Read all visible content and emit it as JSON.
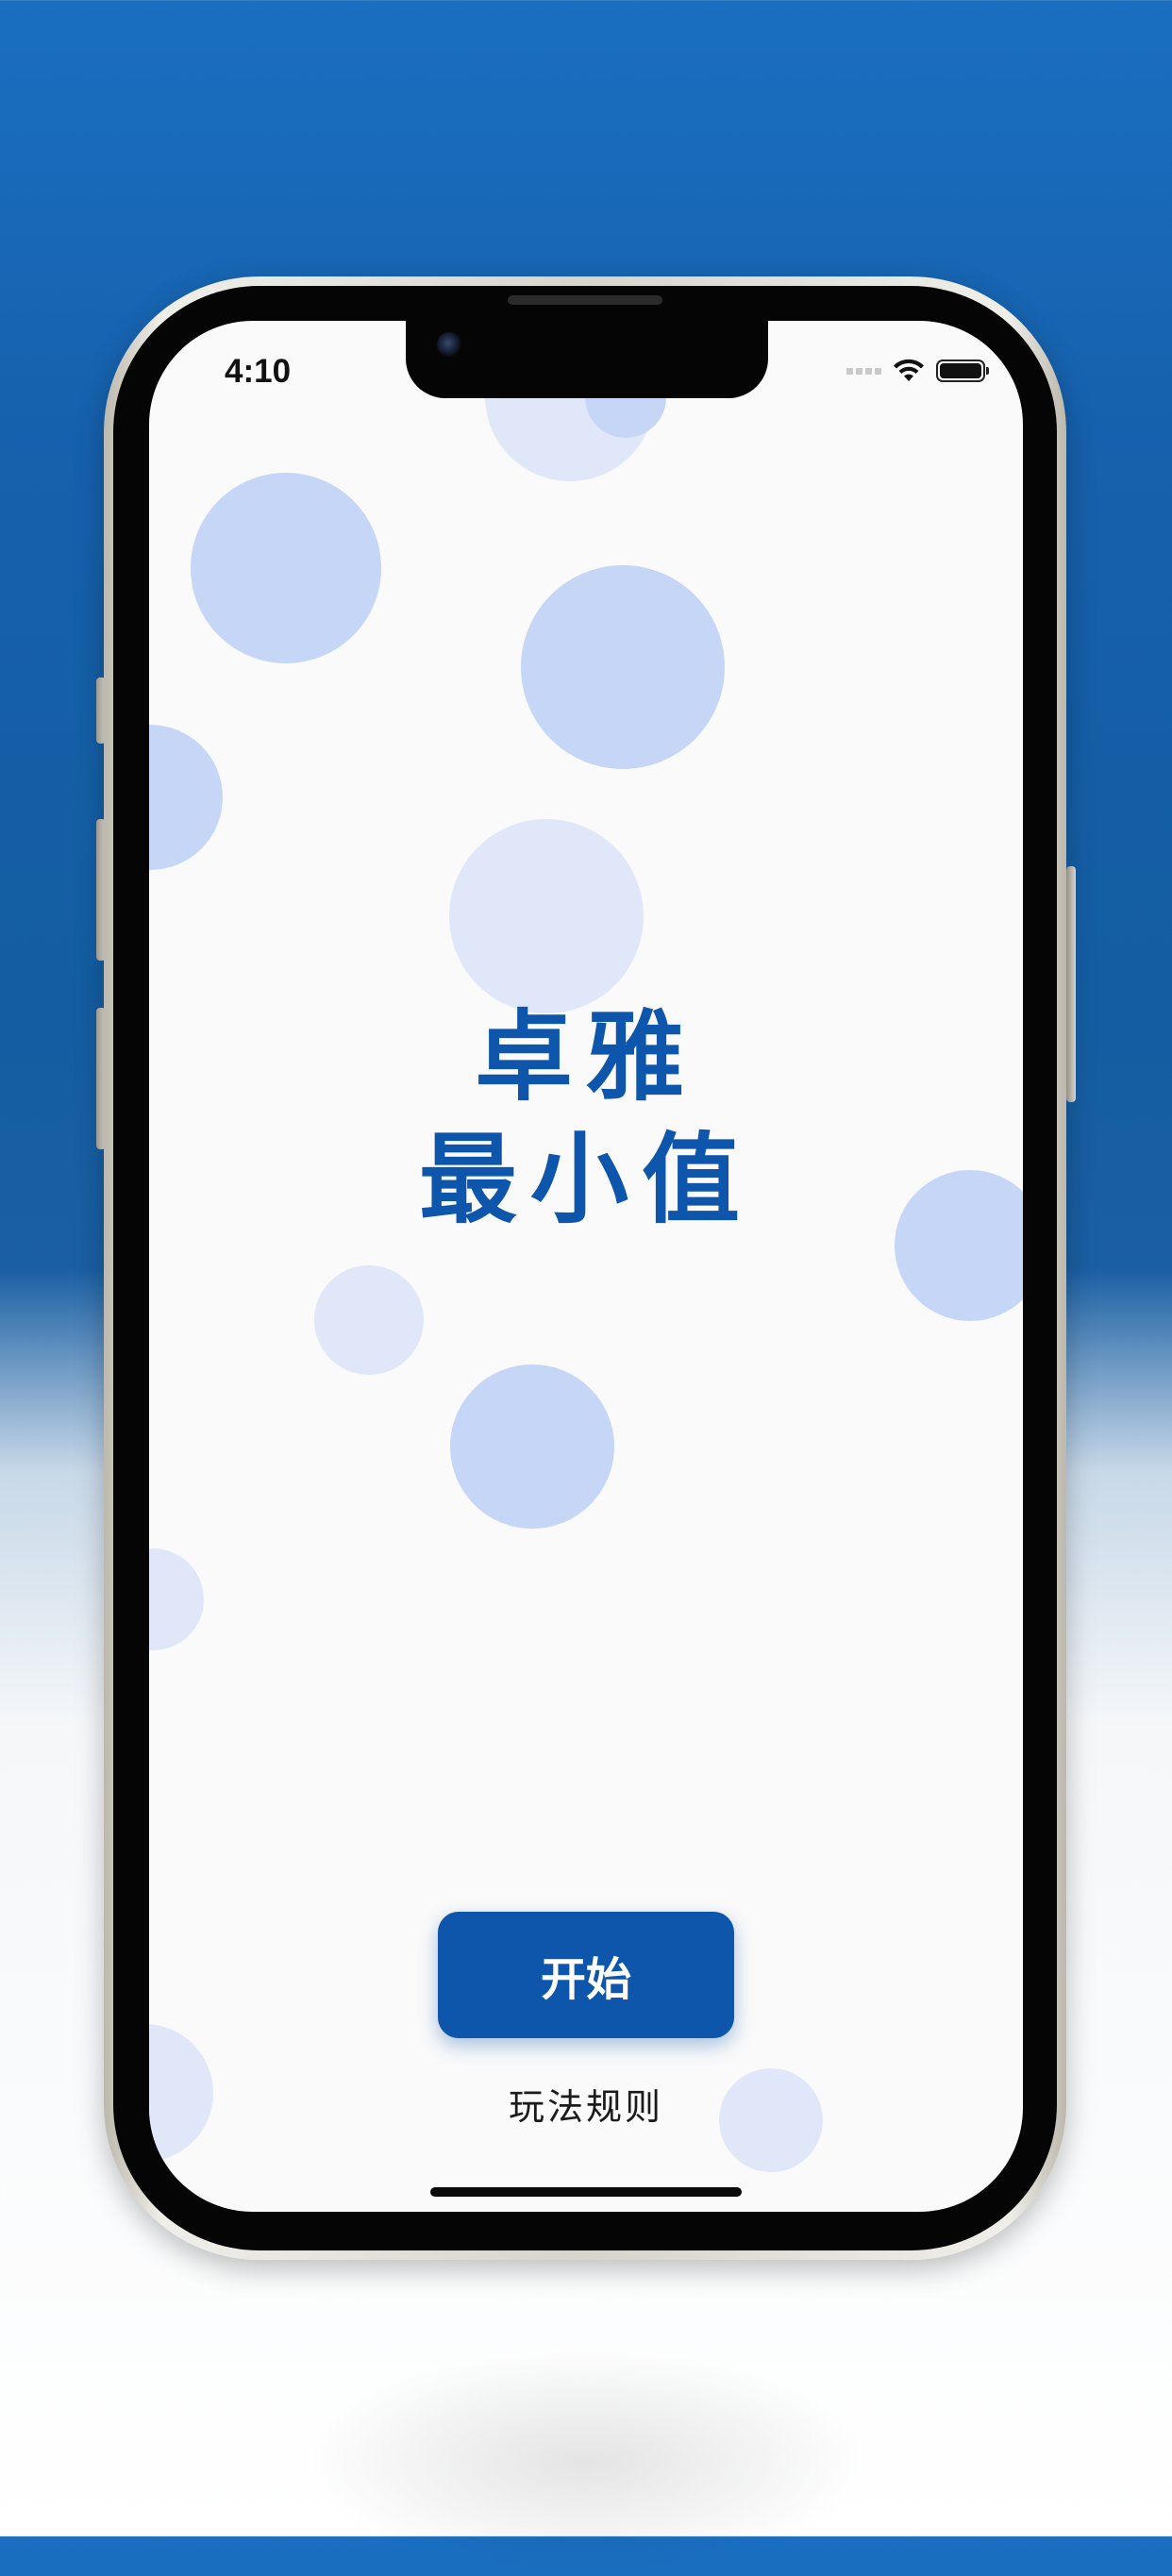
{
  "status_bar": {
    "time": "4:10",
    "icons": [
      "signal-icon",
      "wifi-icon",
      "battery-icon"
    ]
  },
  "title": {
    "line1": "卓雅",
    "line2": "最小值"
  },
  "buttons": {
    "start_label": "开始",
    "rules_label": "玩法规则"
  },
  "colors": {
    "brand": "#0d56ac",
    "bubble_dark": "#c5d6f7",
    "bubble_light": "#dfe7f9",
    "screen_bg": "#fafafa"
  }
}
